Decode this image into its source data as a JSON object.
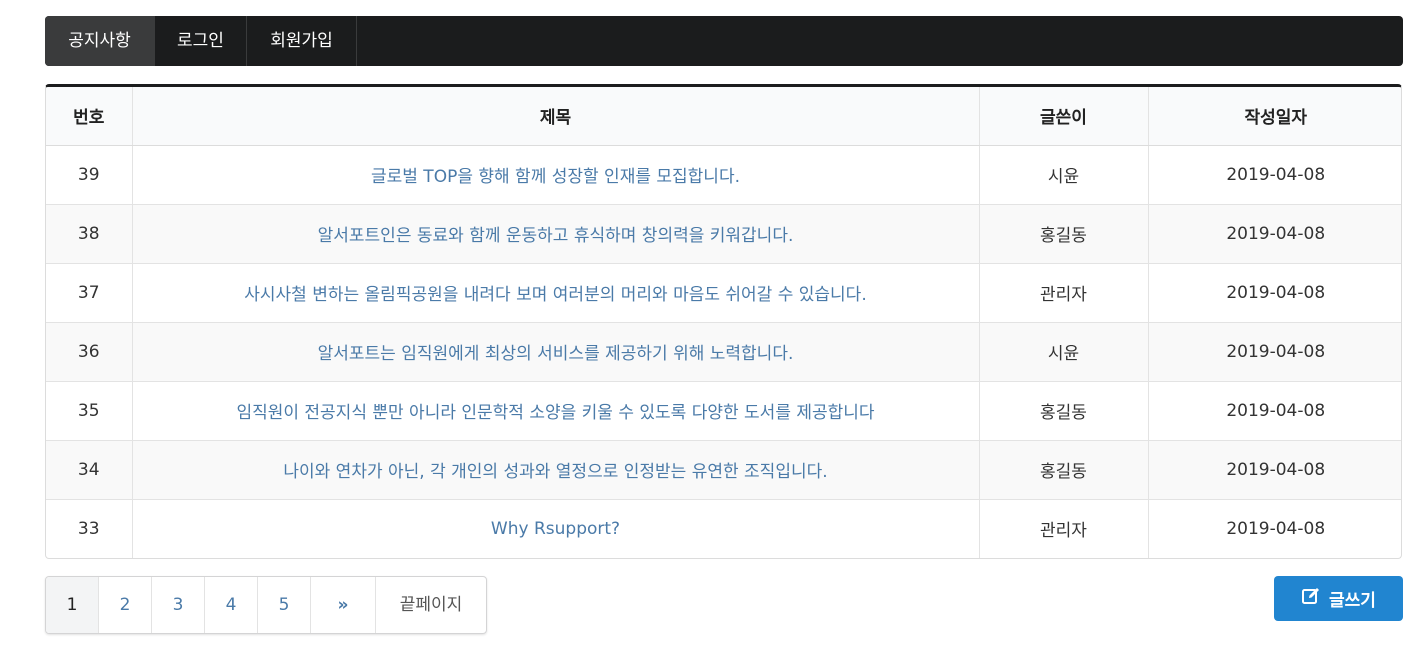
{
  "nav": {
    "items": [
      {
        "label": "공지사항",
        "active": true
      },
      {
        "label": "로그인",
        "active": false
      },
      {
        "label": "회원가입",
        "active": false
      }
    ]
  },
  "table": {
    "headers": [
      "번호",
      "제목",
      "글쓴이",
      "작성일자"
    ],
    "rows": [
      {
        "num": "39",
        "title": "글로벌 TOP을 향해 함께 성장할 인재를 모집합니다.",
        "writer": "시윤",
        "date": "2019-04-08"
      },
      {
        "num": "38",
        "title": "알서포트인은 동료와 함께 운동하고 휴식하며 창의력을 키워갑니다.",
        "writer": "홍길동",
        "date": "2019-04-08"
      },
      {
        "num": "37",
        "title": "사시사철 변하는 올림픽공원을 내려다 보며 여러분의 머리와 마음도 쉬어갈 수 있습니다.",
        "writer": "관리자",
        "date": "2019-04-08"
      },
      {
        "num": "36",
        "title": "알서포트는 임직원에게 최상의 서비스를 제공하기 위해 노력합니다.",
        "writer": "시윤",
        "date": "2019-04-08"
      },
      {
        "num": "35",
        "title": "임직원이 전공지식 뿐만 아니라 인문학적 소양을 키울 수 있도록 다양한 도서를 제공합니다",
        "writer": "홍길동",
        "date": "2019-04-08"
      },
      {
        "num": "34",
        "title": "나이와 연차가 아닌, 각 개인의 성과와 열정으로 인정받는 유연한 조직입니다.",
        "writer": "홍길동",
        "date": "2019-04-08"
      },
      {
        "num": "33",
        "title": "Why Rsupport?",
        "writer": "관리자",
        "date": "2019-04-08"
      }
    ]
  },
  "pagination": {
    "pages": [
      "1",
      "2",
      "3",
      "4",
      "5"
    ],
    "current": "1",
    "next_label": "»",
    "last_label": "끝페이지"
  },
  "write_button": {
    "label": "글쓰기",
    "icon": "edit-icon"
  },
  "colors": {
    "navbar": "#1b1c1d",
    "link": "#4a7aa8",
    "primary": "#2185d0"
  }
}
